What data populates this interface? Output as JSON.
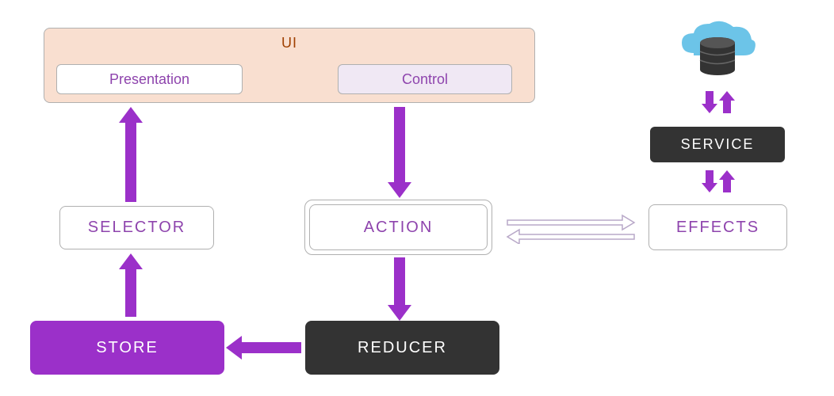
{
  "diagram": {
    "ui": {
      "label": "UI",
      "presentation": "Presentation",
      "control": "Control"
    },
    "selector": "SELECTOR",
    "action": "ACTION",
    "store": "STORE",
    "reducer": "REDUCER",
    "effects": "EFFECTS",
    "service": "SERVICE"
  },
  "flows": [
    {
      "from": "Control",
      "to": "Action",
      "style": "solid-purple-down"
    },
    {
      "from": "Action",
      "to": "Reducer",
      "style": "solid-purple-down"
    },
    {
      "from": "Reducer",
      "to": "Store",
      "style": "solid-purple-left"
    },
    {
      "from": "Store",
      "to": "Selector",
      "style": "solid-purple-up"
    },
    {
      "from": "Selector",
      "to": "Presentation",
      "style": "solid-purple-up"
    },
    {
      "from": "Action",
      "to": "Effects",
      "style": "outline-bidirectional"
    },
    {
      "from": "Effects",
      "to": "Service",
      "style": "solid-purple-bidirectional"
    },
    {
      "from": "Service",
      "to": "CloudDatabase",
      "style": "solid-purple-bidirectional"
    }
  ],
  "colors": {
    "purple": "#9b30c9",
    "dark": "#333333",
    "peach": "#f9dfd0",
    "cloud": "#6cc4e8",
    "textPurple": "#8e44ad"
  }
}
